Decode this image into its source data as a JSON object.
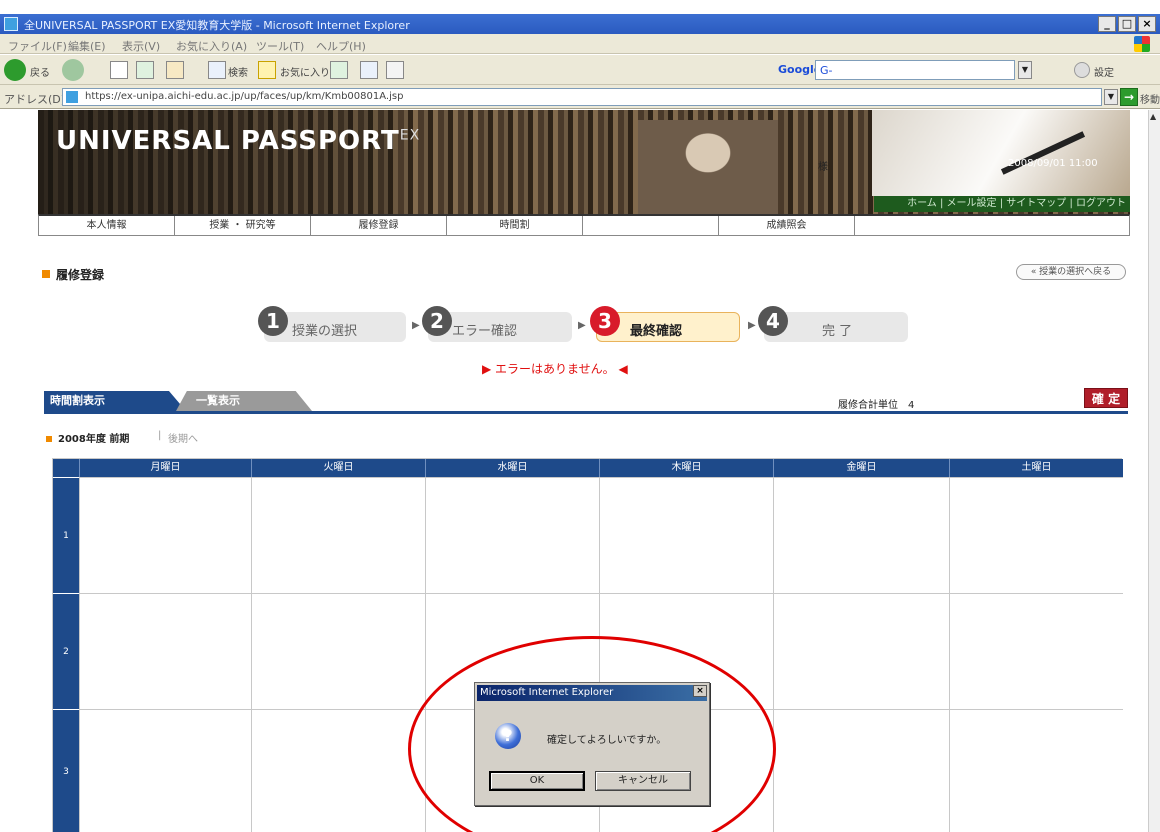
{
  "window": {
    "title": "全UNIVERSAL PASSPORT EX愛知教育大学版 - Microsoft Internet Explorer",
    "controls": [
      "_",
      "□",
      "×"
    ]
  },
  "menu": {
    "items": [
      "ファイル(F)",
      "編集(E)",
      "表示(V)",
      "お気に入り(A)",
      "ツール(T)",
      "ヘルプ(H)"
    ]
  },
  "toolbar": {
    "back": "戻る",
    "search": "検索",
    "favorites": "お気に入り",
    "google_label": "Google",
    "google_value": "G-",
    "settings": "設定"
  },
  "address": {
    "label": "アドレス(D)",
    "url": "https://ex-unipa.aichi-edu.ac.jp/up/faces/up/km/Kmb00801A.jsp",
    "go_label": "移動"
  },
  "banner": {
    "brand": "UNIVERSAL PASSPORT",
    "brand_sup": "EX",
    "user": "様",
    "date": "2008/09/01 11:00",
    "links": "ホーム | メール設定 | サイトマップ | ログアウト"
  },
  "nav": {
    "tabs": [
      "本人情報",
      "授業 ・ 研究等",
      "履修登録",
      "時間割",
      "",
      "成績照会"
    ]
  },
  "section": {
    "title": "履修登録",
    "back_button": "« 授業の選択へ戻る"
  },
  "steps": [
    {
      "num": "1",
      "label": "授業の選択"
    },
    {
      "num": "2",
      "label": "エラー確認"
    },
    {
      "num": "3",
      "label": "最終確認"
    },
    {
      "num": "4",
      "label": "完 了"
    }
  ],
  "status": {
    "message": "▶ エラーはありません。 ◀"
  },
  "view_tabs": {
    "timetable": "時間割表示",
    "list": "一覧表示",
    "credits": "履修合計単位　4",
    "confirm": "確 定"
  },
  "term": {
    "label": "2008年度 前期",
    "sep": "|",
    "link": "後期へ"
  },
  "timetable": {
    "days": [
      "月曜日",
      "火曜日",
      "水曜日",
      "木曜日",
      "金曜日",
      "土曜日"
    ],
    "periods": [
      "1",
      "2",
      "3"
    ]
  },
  "dialog": {
    "title": "Microsoft Internet Explorer",
    "close": "×",
    "icon": "?",
    "message": "確定してよろしいですか。",
    "ok": "OK",
    "cancel": "キャンセル"
  }
}
